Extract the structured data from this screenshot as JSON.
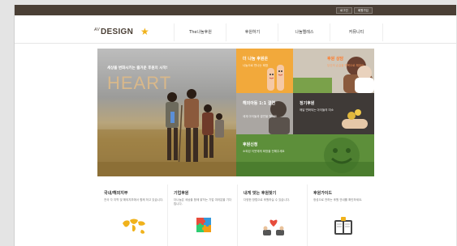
{
  "topbar": {
    "login": "로그인",
    "join": "회원가입"
  },
  "logo": {
    "prefix": "AV",
    "text": "DESIGN"
  },
  "nav": [
    "The나눔후원",
    "후원하기",
    "나눔엘레스",
    "커뮤니티"
  ],
  "hero": {
    "tagline": "세상을 변화시키는 즐거운 후원의 시작!",
    "title": "HEART"
  },
  "tiles": [
    {
      "title": "더 나눔 후원은",
      "desc": "나눔으로 만나는 희망"
    },
    {
      "title": "후원 상담",
      "desc": "당신의 손길을 행복으로 채워요"
    },
    {
      "title": "해외아동 1:1 결연",
      "desc": "세계 아이들과 결연을 맺어요"
    },
    {
      "title": "정기후원",
      "desc": "매달 변화되는 아이들의 미소"
    },
    {
      "title": "후원신청",
      "desc": "소외된 이웃에게 희망을 전해주세요"
    }
  ],
  "sections": [
    {
      "title": "국내/해외지부",
      "desc": "전국 각 지역 및 해외지부에서 함께 하고 있습니다.",
      "icon": "world-map-icon"
    },
    {
      "title": "기업후원",
      "desc": "더나눔은 세상을 함께 밝히는 기업 여러분을 기다립니다.",
      "icon": "puzzle-icon"
    },
    {
      "title": "내게 맞는 후원찾기",
      "desc": "다양한 방법으로 후원하실 수 있습니다.",
      "icon": "heart-hands-icon"
    },
    {
      "title": "후원가이드",
      "desc": "정성으로 전하는 후원 안내를 확인하세요.",
      "icon": "guide-book-icon"
    }
  ],
  "colors": {
    "topbar": "#4a3f35",
    "accent": "#f2a93b",
    "green": "#5d8f3a"
  }
}
